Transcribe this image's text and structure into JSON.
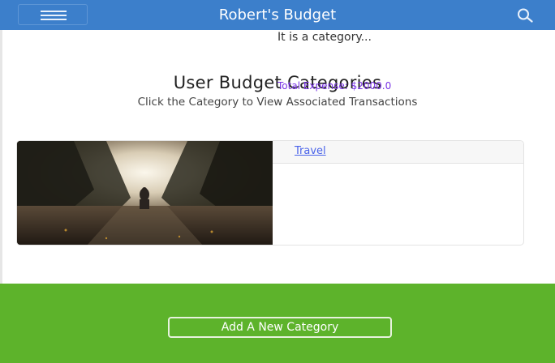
{
  "header": {
    "title": "Robert's Budget",
    "menu_icon": "hamburger-icon",
    "search_icon": "search-icon"
  },
  "main": {
    "title": "User Budget Categories",
    "subtitle": "Click the Category to View Associated Transactions"
  },
  "categories": [
    {
      "name": "Travel",
      "description": "It is a category...",
      "total_expense": "Total Expense: $2000.0",
      "image": "forest-path-photo"
    }
  ],
  "footer": {
    "add_label": "Add A New Category"
  },
  "colors": {
    "header_bg": "#3c7fcb",
    "footer_bg": "#5db32b",
    "link": "#4a63ea",
    "expense_text": "#7a35e6"
  }
}
